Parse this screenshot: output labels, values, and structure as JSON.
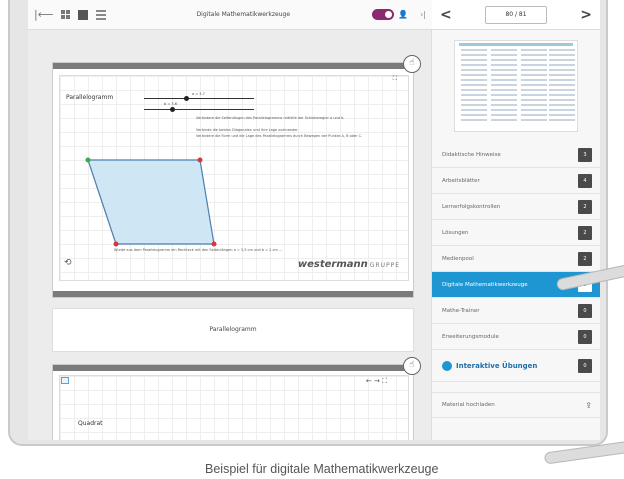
{
  "toolbar": {
    "collapse_left_icon": "collapse-left-icon",
    "title": "Digitale Mathematikwerkzeuge",
    "person_glyph": "👤",
    "collapse_right_glyph": "›|"
  },
  "pagenav": {
    "prev_glyph": "<",
    "page": "80 / 81",
    "next_glyph": ">"
  },
  "content": {
    "card1": {
      "heading": "Parallelogramm",
      "slider1_label": "a = 3.7",
      "slider2_label": "b = 3.6",
      "desc1": "Verändere die Seitenlängen des Parallelogramms mithilfe der Schieberegler a und b.",
      "desc2": "Verbinde die beiden Diagonalen und ihre Lage zueinander.",
      "desc3": "Verändere die Form und die Lage des Parallelogramms durch Bewegen der Punkte A, B oder C.",
      "measure": "Wurde aus dem Parallelogramm ein Rechteck mit den Seitenlängen a = 3,5 cm und b = 2 cm ...",
      "brand": "westermann",
      "brand_gruppe": "GRUPPE",
      "reset_glyph": "⟲",
      "hand_glyph": "☝",
      "fullscreen_glyph": "⛶"
    },
    "caption": "Parallelogramm",
    "card2": {
      "heading": "Quadrat",
      "arrows": "← → ⛶",
      "hand_glyph": "☝"
    }
  },
  "sidebar": {
    "items": [
      {
        "label": "Didaktische Hinweise",
        "count": "3"
      },
      {
        "label": "Arbeitsblätter",
        "count": "4"
      },
      {
        "label": "Lernerfolgskontrollen",
        "count": "2"
      },
      {
        "label": "Lösungen",
        "count": "2"
      },
      {
        "label": "Medienpool",
        "count": "2"
      },
      {
        "label": "Digitale Mathematikwerkzeuge",
        "count": "1"
      },
      {
        "label": "Mathe-Trainer",
        "count": "0"
      },
      {
        "label": "Erweiterungsmodule",
        "count": "0"
      }
    ],
    "interactive_label": "Interaktive Übungen",
    "interactive_count": "0",
    "material_label": "Material hochladen",
    "upload_glyph": "⇪"
  },
  "caption": "Beispiel für digitale Mathematikwerkzeuge",
  "colors": {
    "accent": "#1e96d2",
    "toggle": "#8b2a6f",
    "badge": "#4a4a4a"
  },
  "chart_data": {
    "type": "scatter",
    "title": "Parallelogramm",
    "x": [
      1,
      3,
      10,
      9
    ],
    "y": [
      8,
      2,
      2,
      8
    ],
    "xlabel": "",
    "ylabel": ""
  }
}
